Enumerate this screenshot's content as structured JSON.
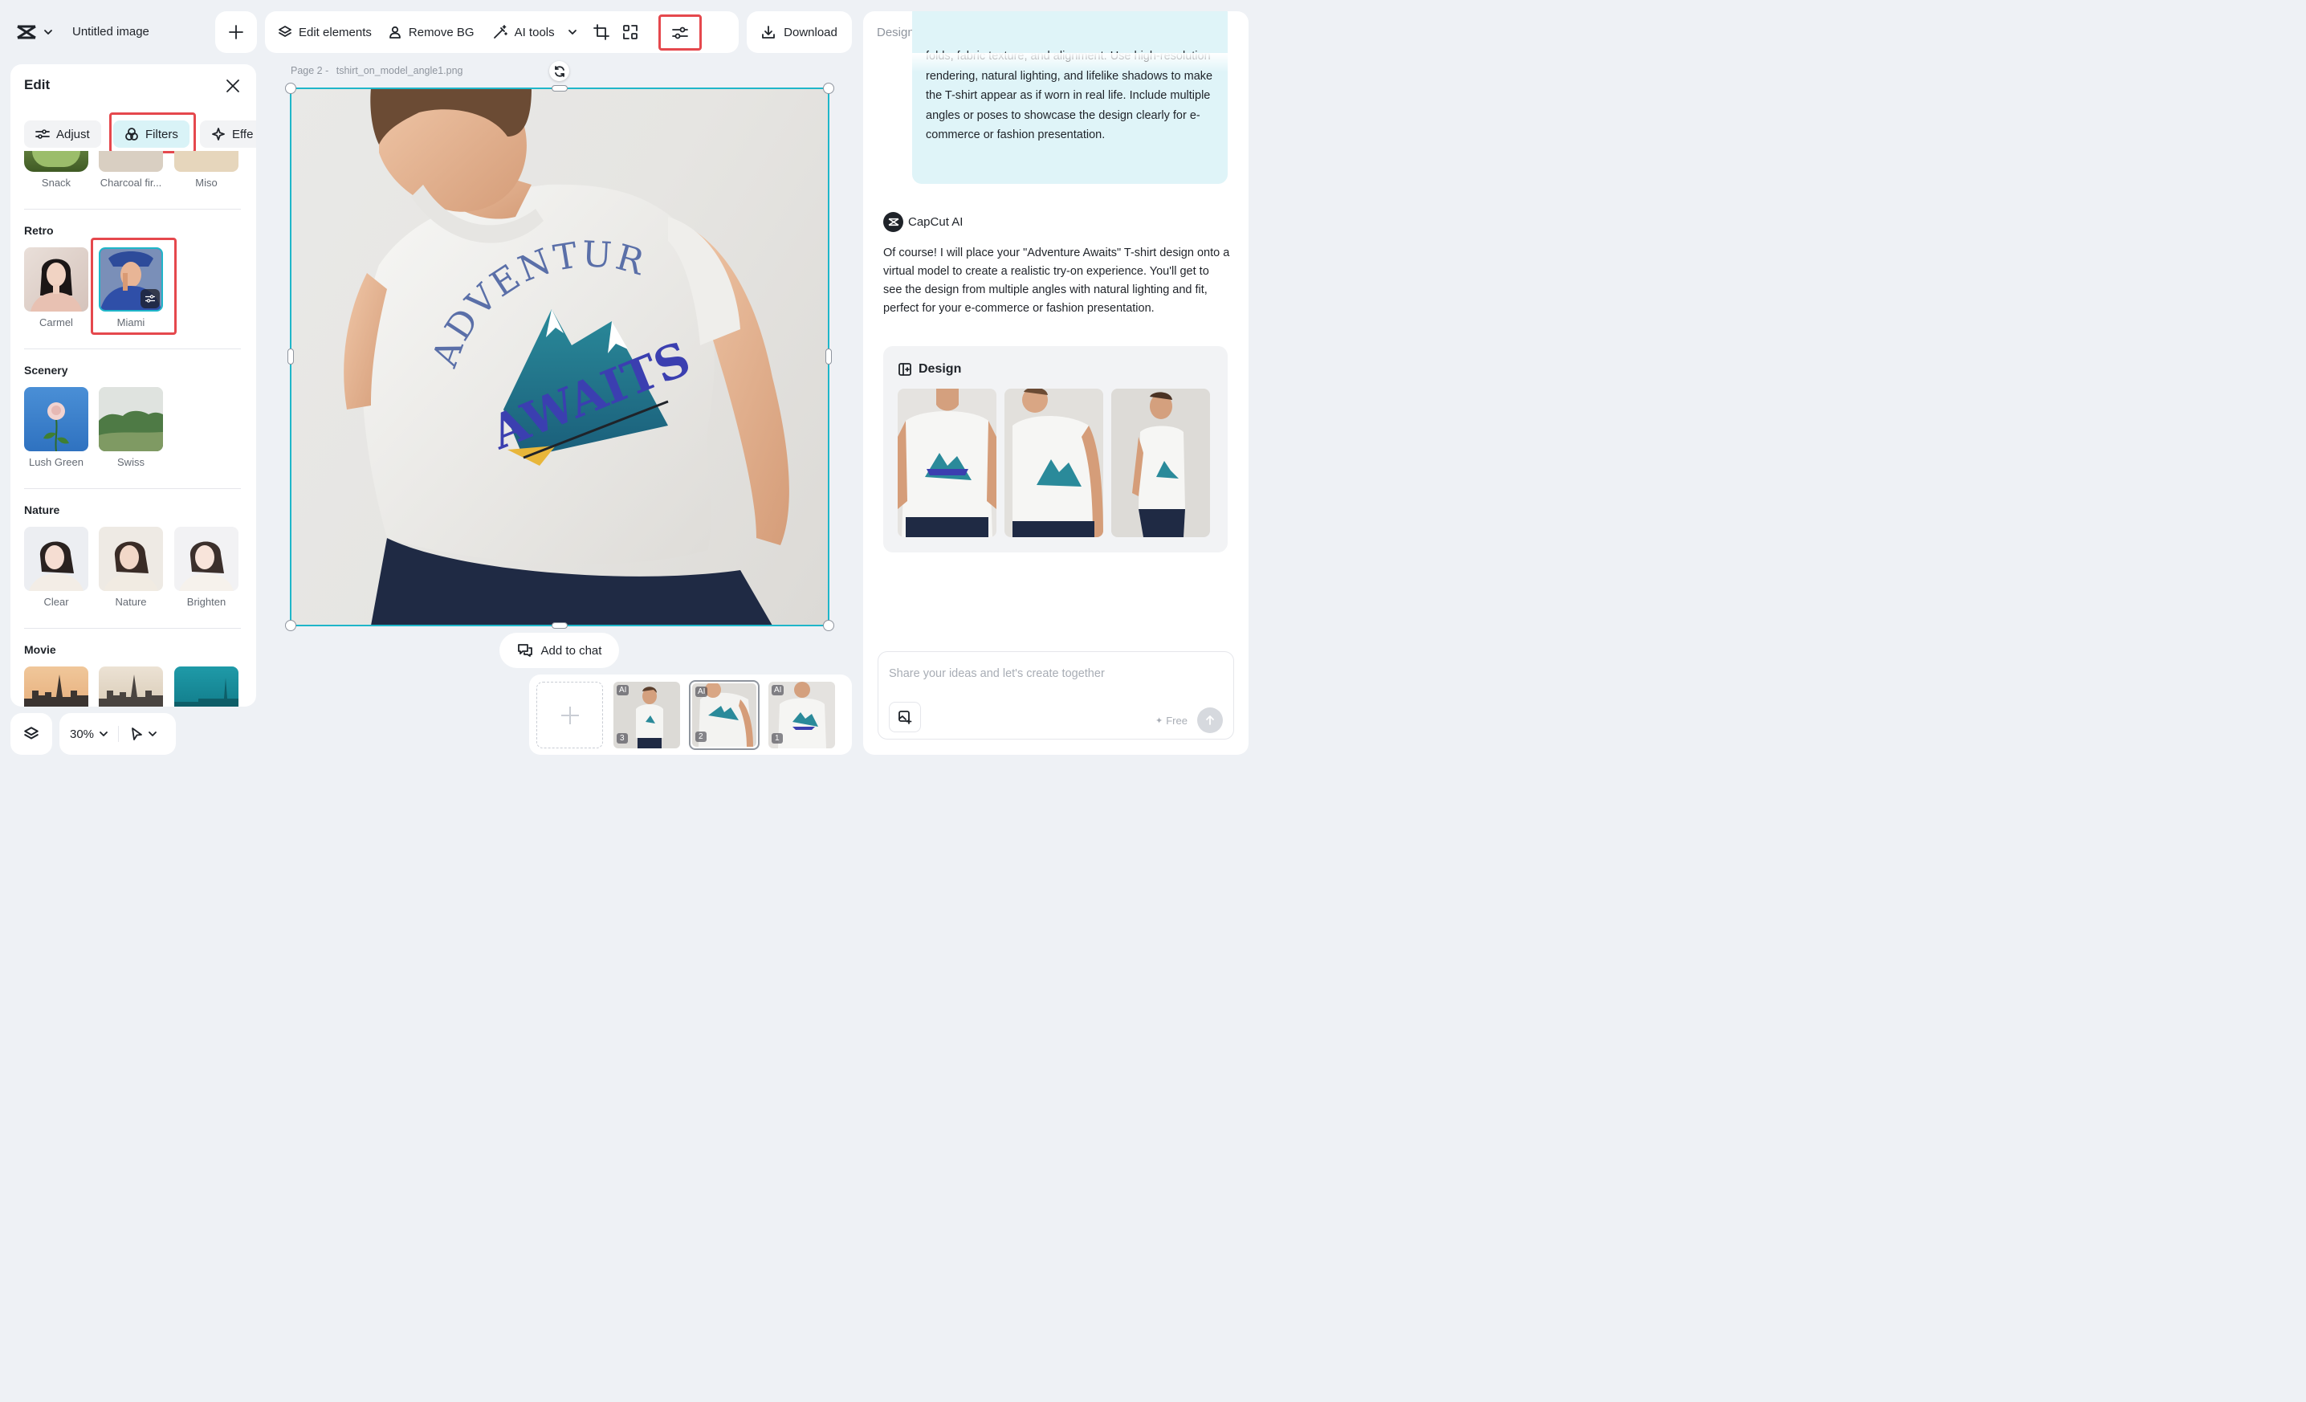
{
  "app": {
    "title": "Untitled image",
    "logo": "capcut-logo"
  },
  "toolbar": {
    "edit_elements": "Edit elements",
    "remove_bg": "Remove BG",
    "ai_tools": "AI tools",
    "download": "Download"
  },
  "edit_panel": {
    "title": "Edit",
    "tabs": [
      {
        "label": "Adjust",
        "active": false
      },
      {
        "label": "Filters",
        "active": true
      },
      {
        "label": "Effe",
        "active": false
      }
    ],
    "top_row": [
      "Snack",
      "Charcoal fir...",
      "Miso"
    ],
    "sections": [
      {
        "title": "Retro",
        "items": [
          "Carmel",
          "Miami"
        ],
        "selected": "Miami"
      },
      {
        "title": "Scenery",
        "items": [
          "Lush Green",
          "Swiss"
        ]
      },
      {
        "title": "Nature",
        "items": [
          "Clear",
          "Nature",
          "Brighten"
        ]
      },
      {
        "title": "Movie",
        "items": []
      }
    ]
  },
  "canvas": {
    "page_label": "Page 2 -",
    "file_name": "tshirt_on_model_angle1.png",
    "tshirt_text_top": "ADVENTURE",
    "tshirt_text_bottom": "AWAITS",
    "add_to_chat": "Add to chat"
  },
  "bottom_left": {
    "zoom": "30%"
  },
  "pages": [
    {
      "number": "3",
      "badge": "AI"
    },
    {
      "number": "2",
      "badge": "AI",
      "selected": true
    },
    {
      "number": "1",
      "badge": "AI"
    }
  ],
  "ai_panel": {
    "title": "Design with AI",
    "user_message": "folds, fabric texture, and alignment. Use high-resolution rendering, natural lighting, and lifelike shadows to make the T-shirt appear as if worn in real life. Include multiple angles or poses to showcase the design clearly for e-commerce or fashion presentation.",
    "assistant_name": "CapCut AI",
    "assistant_message": "Of course! I will place your \"Adventure Awaits\" T-shirt design onto a virtual model to create a realistic try-on experience. You'll get to see the design from multiple angles with natural lighting and fit, perfect for your e-commerce or fashion presentation.",
    "design_title": "Design",
    "input_placeholder": "Share your ideas and let's create together",
    "free_label": "Free"
  },
  "colors": {
    "accent": "#1fb6c9",
    "highlight": "#e5484d",
    "user_bubble": "#dff4f8"
  }
}
